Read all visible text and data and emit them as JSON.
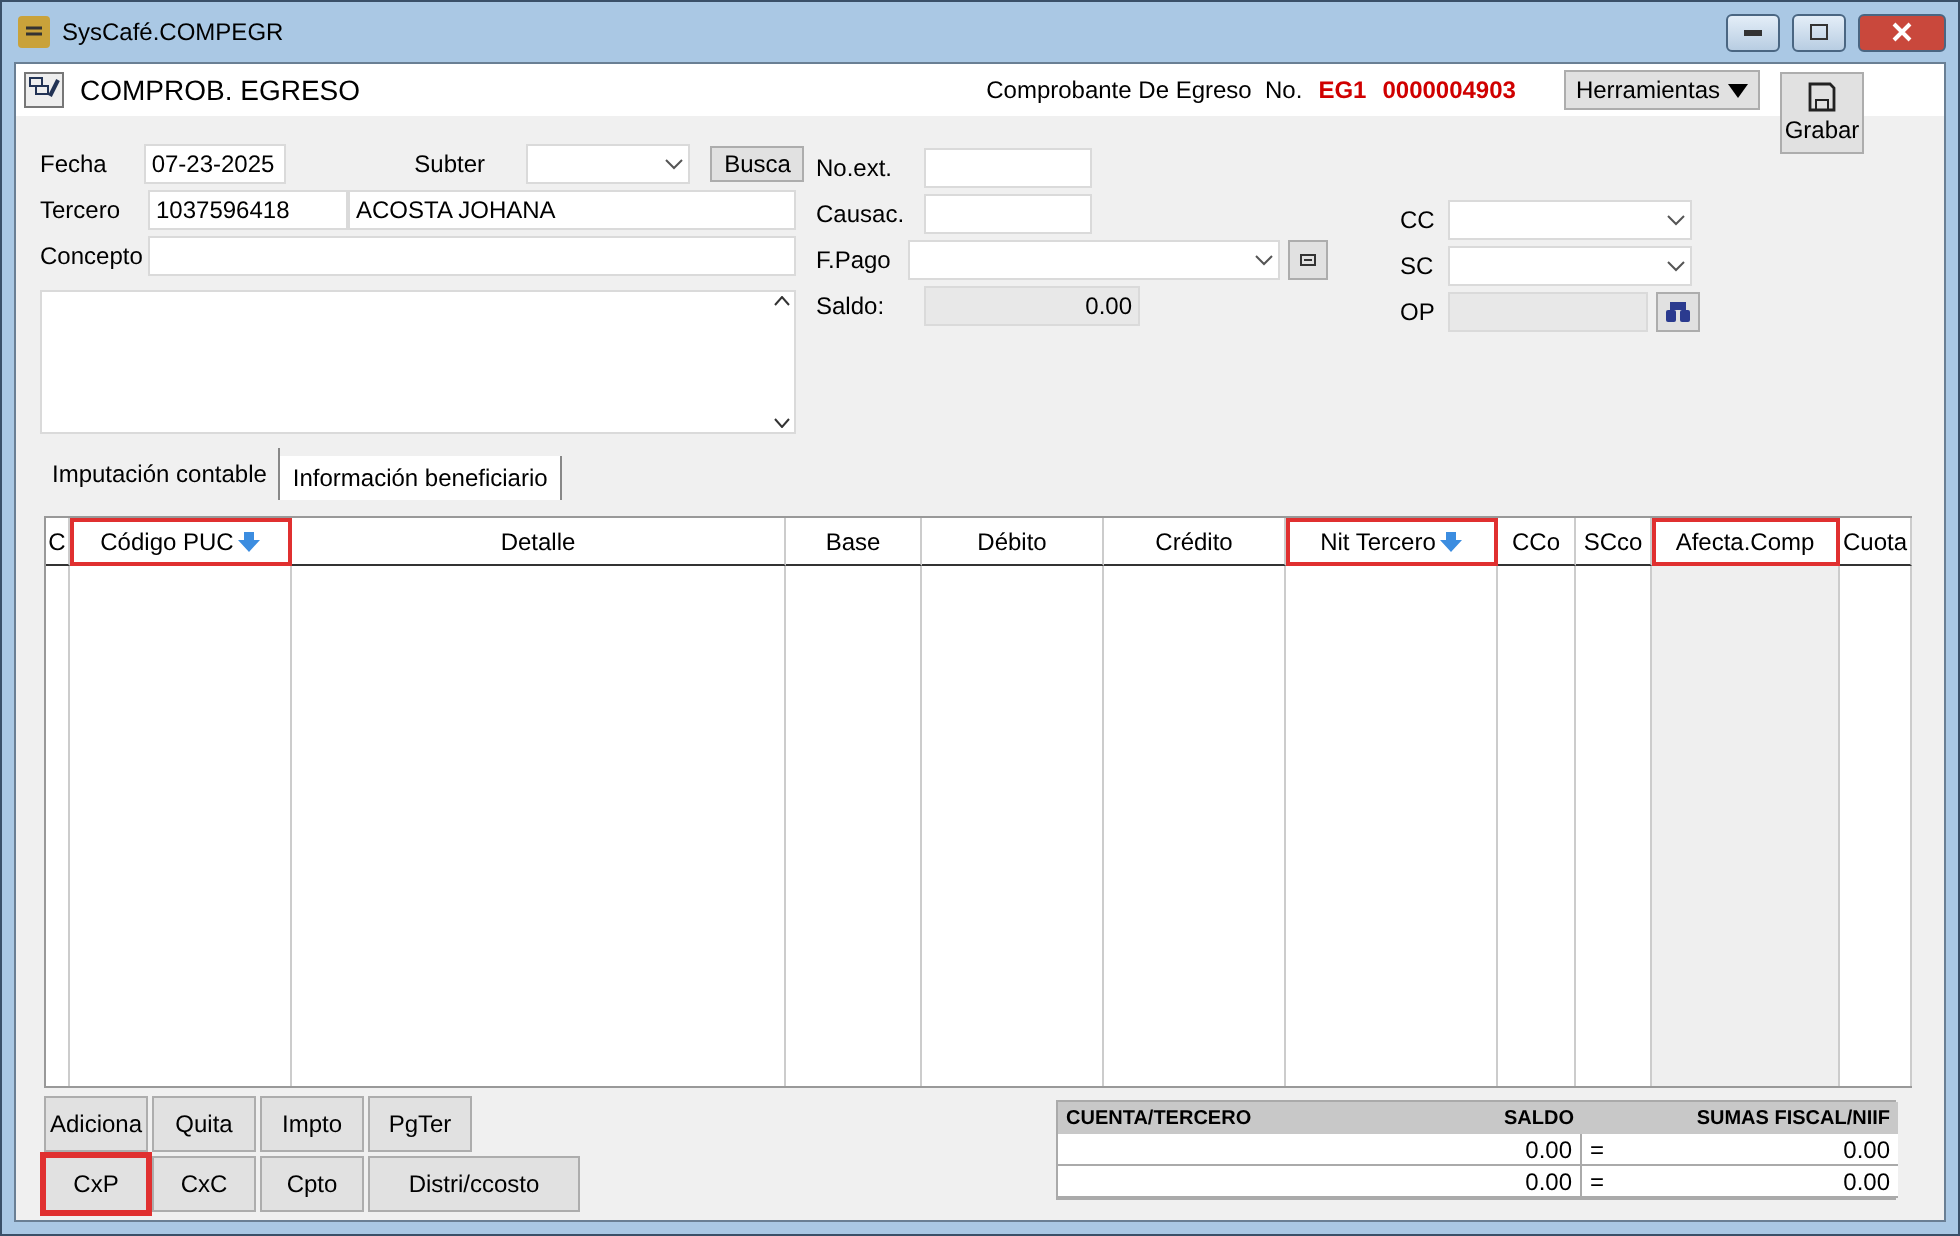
{
  "window": {
    "title": "SysCafé.COMPEGR"
  },
  "header": {
    "title": "COMPROB. EGRESO",
    "doc_label": "Comprobante De Egreso  No.",
    "doc_prefix": "EG1",
    "doc_number": "0000004903",
    "tools_button": "Herramientas",
    "save_button": "Grabar"
  },
  "form": {
    "fecha": {
      "label": "Fecha",
      "value": "07-23-2025"
    },
    "subter": {
      "label": "Subter"
    },
    "busca_button": "Busca",
    "tercero": {
      "label": "Tercero",
      "id": "1037596418",
      "name": "ACOSTA JOHANA"
    },
    "concepto": {
      "label": "Concepto"
    },
    "no_ext": {
      "label": "No.ext."
    },
    "causac": {
      "label": "Causac."
    },
    "f_pago": {
      "label": "F.Pago"
    },
    "saldo": {
      "label": "Saldo:",
      "value": "0.00"
    },
    "cc": {
      "label": "CC"
    },
    "sc": {
      "label": "SC"
    },
    "op": {
      "label": "OP"
    }
  },
  "tabs": [
    {
      "label": "Imputación contable",
      "selected": true
    },
    {
      "label": "Información beneficiario",
      "selected": false
    }
  ],
  "table": {
    "columns": [
      {
        "label": "C",
        "highlighted": false,
        "sort_arrow": false,
        "shaded": false
      },
      {
        "label": "Código PUC",
        "highlighted": true,
        "sort_arrow": true,
        "shaded": false
      },
      {
        "label": "Detalle",
        "highlighted": false,
        "sort_arrow": false,
        "shaded": false
      },
      {
        "label": "Base",
        "highlighted": false,
        "sort_arrow": false,
        "shaded": false
      },
      {
        "label": "Débito",
        "highlighted": false,
        "sort_arrow": false,
        "shaded": false
      },
      {
        "label": "Crédito",
        "highlighted": false,
        "sort_arrow": false,
        "shaded": false
      },
      {
        "label": "Nit Tercero",
        "highlighted": true,
        "sort_arrow": true,
        "shaded": false
      },
      {
        "label": "CCo",
        "highlighted": false,
        "sort_arrow": false,
        "shaded": false
      },
      {
        "label": "SCco",
        "highlighted": false,
        "sort_arrow": false,
        "shaded": false
      },
      {
        "label": "Afecta.Comp",
        "highlighted": true,
        "sort_arrow": false,
        "shaded": true
      },
      {
        "label": "Cuota",
        "highlighted": false,
        "sort_arrow": false,
        "shaded": false
      }
    ]
  },
  "buttons": [
    [
      {
        "label": "Adiciona",
        "highlighted": false
      },
      {
        "label": "Quita",
        "highlighted": false
      },
      {
        "label": "Impto",
        "highlighted": false
      },
      {
        "label": "PgTer",
        "highlighted": false
      }
    ],
    [
      {
        "label": "CxP",
        "highlighted": true
      },
      {
        "label": "CxC",
        "highlighted": false
      },
      {
        "label": "Cpto",
        "highlighted": false
      },
      {
        "label": "Distri/ccosto",
        "highlighted": false
      }
    ]
  ],
  "totals": {
    "columns": [
      "CUENTA/TERCERO",
      "SALDO",
      "SUMAS FISCAL/NIIF"
    ],
    "rows": [
      {
        "saldo": "0.00",
        "equals": "=",
        "sumas": "0.00"
      },
      {
        "saldo": "0.00",
        "equals": "=",
        "sumas": "0.00"
      }
    ]
  }
}
